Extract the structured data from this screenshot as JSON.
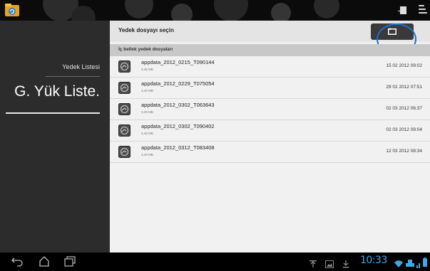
{
  "actionbar": {
    "app_icon": "backup-app-icon",
    "overflow_icon": "overflow-menu-icon",
    "square_icon": "square-icon"
  },
  "sidebar": {
    "items": [
      {
        "label": "Yedek Listesi"
      },
      {
        "label": "G. Yük Liste."
      }
    ]
  },
  "main": {
    "title": "Yedek dosyayı seçin",
    "folder_button_icon": "folder-icon",
    "section_title": "İç bellek yedek dosyaları",
    "files": [
      {
        "name": "appdata_2012_0215_T090144",
        "size": "3,45 MB",
        "date": "15 02 2012 09:02"
      },
      {
        "name": "appdata_2012_0229_T075054",
        "size": "3,45 MB",
        "date": "29 02 2012 07:51"
      },
      {
        "name": "appdata_2012_0302_T063643",
        "size": "3,48 MB",
        "date": "02 03 2012 06:37"
      },
      {
        "name": "appdata_2012_0302_T090402",
        "size": "3,48 MB",
        "date": "02 03 2012 09:04"
      },
      {
        "name": "appdata_2012_0312_T083408",
        "size": "3,48 MB",
        "date": "12 03 2012 08:34"
      }
    ]
  },
  "navbar": {
    "clock": "10:33",
    "accent_color": "#3fa9e6"
  }
}
